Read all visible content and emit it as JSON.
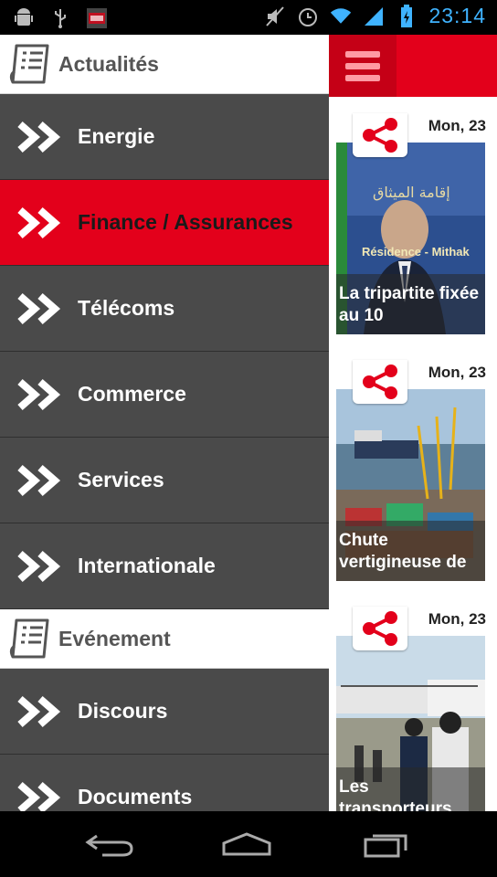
{
  "status_bar": {
    "time": "23:14",
    "icons": [
      "android-debug-icon",
      "usb-icon",
      "nrj-app-icon",
      "mute-icon",
      "alarm-icon",
      "wifi-icon",
      "signal-icon",
      "battery-icon"
    ],
    "time_color": "#3fb3ff"
  },
  "drawer": {
    "sections": [
      {
        "title": "Actualités",
        "items": [
          {
            "label": "Energie",
            "active": false
          },
          {
            "label": "Finance / Assurances",
            "active": true
          },
          {
            "label": "Télécoms",
            "active": false
          },
          {
            "label": "Commerce",
            "active": false
          },
          {
            "label": "Services",
            "active": false
          },
          {
            "label": "Internationale",
            "active": false
          }
        ]
      },
      {
        "title": "Evénement",
        "items": [
          {
            "label": "Discours",
            "active": false
          },
          {
            "label": "Documents",
            "active": false
          }
        ]
      }
    ],
    "accent_color": "#e3001b"
  },
  "feed": {
    "cards": [
      {
        "date": "Mon, 23",
        "caption": "La tripartite fixée au 10",
        "image_text": "Résidence - Mithak"
      },
      {
        "date": "Mon, 23",
        "caption": "Chute vertigineuse de"
      },
      {
        "date": "Mon, 23",
        "caption": "Les transporteurs"
      }
    ]
  },
  "nav_bar": {
    "buttons": [
      "back-icon",
      "home-icon",
      "recent-apps-icon"
    ]
  }
}
